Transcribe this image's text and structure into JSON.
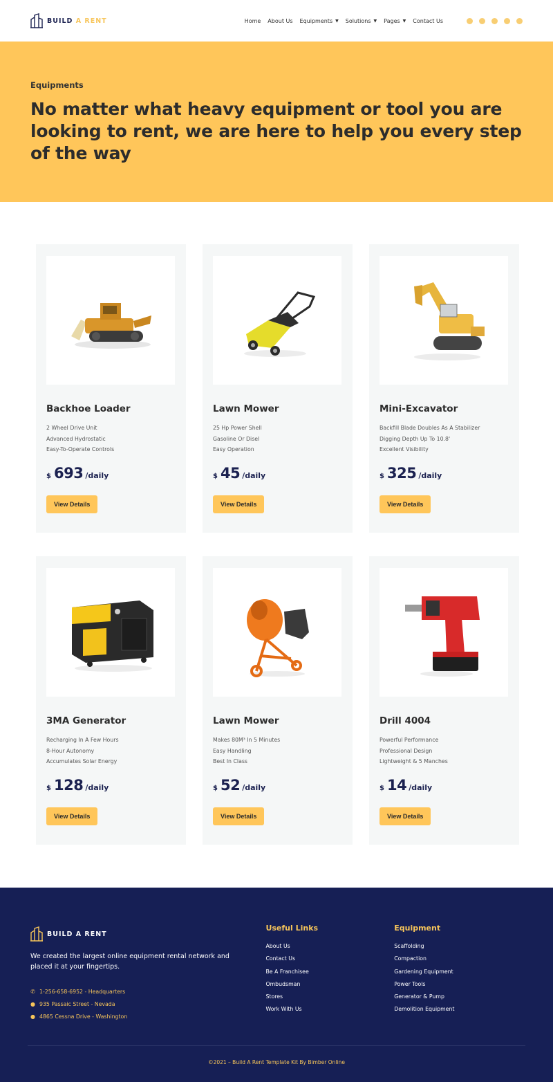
{
  "header": {
    "logo_primary": "BUILD",
    "logo_accent": "A RENT",
    "nav": [
      {
        "label": "Home",
        "dropdown": false
      },
      {
        "label": "About Us",
        "dropdown": false
      },
      {
        "label": "Equipments",
        "dropdown": true
      },
      {
        "label": "Solutions",
        "dropdown": true
      },
      {
        "label": "Pages",
        "dropdown": true
      },
      {
        "label": "Contact Us",
        "dropdown": false
      }
    ],
    "socials": [
      "instagram-icon",
      "facebook-icon",
      "twitter-icon",
      "youtube-icon",
      "dribbble-icon"
    ]
  },
  "hero": {
    "eyebrow": "Equipments",
    "title": "No matter what heavy equipment or tool you are looking to rent, we are here to help you every step of the way"
  },
  "products": [
    {
      "title": "Backhoe Loader",
      "features": [
        "2 Wheel Drive Unit",
        "Advanced Hydrostatic",
        "Easy-To-Operate Controls"
      ],
      "currency": "$",
      "price": "693",
      "per": "/daily",
      "button": "View Details",
      "image": "bulldozer"
    },
    {
      "title": "Lawn Mower",
      "features": [
        "25 Hp Power Shell",
        "Gasoline Or Disel",
        "Easy Operation"
      ],
      "currency": "$",
      "price": "45",
      "per": "/daily",
      "button": "View Details",
      "image": "lawn-mower"
    },
    {
      "title": "Mini-Excavator",
      "features": [
        "Backfill Blade Doubles As A Stabilizer",
        "Digging Depth Up To 10.8'",
        "Excellent Visibility"
      ],
      "currency": "$",
      "price": "325",
      "per": "/daily",
      "button": "View Details",
      "image": "excavator"
    },
    {
      "title": "3MA Generator",
      "features": [
        "Recharging In A Few Hours",
        "8-Hour Autonomy",
        "Accumulates Solar Energy"
      ],
      "currency": "$",
      "price": "128",
      "per": "/daily",
      "button": "View Details",
      "image": "generator"
    },
    {
      "title": "Lawn Mower",
      "features": [
        "Makes 80M³ In 5 Minutes",
        "Easy Handling",
        "Best In Class"
      ],
      "currency": "$",
      "price": "52",
      "per": "/daily",
      "button": "View Details",
      "image": "cement-mixer"
    },
    {
      "title": "Drill 4004",
      "features": [
        "Powerful Performance",
        "Professional Design",
        "Lightweight & 5 Manches"
      ],
      "currency": "$",
      "price": "14",
      "per": "/daily",
      "button": "View Details",
      "image": "drill"
    }
  ],
  "footer": {
    "logo": "BUILD A RENT",
    "description": "We created the largest online equipment rental network and placed it at your fingertips.",
    "contacts": [
      {
        "icon": "phone-icon",
        "text": "1-256-658-6952 - Headquarters"
      },
      {
        "icon": "map-pin-icon",
        "text": "935 Passaic Street - Nevada"
      },
      {
        "icon": "map-pin-icon",
        "text": "4865 Cessna Drive - Washington"
      }
    ],
    "useful_links": {
      "heading": "Useful Links",
      "items": [
        "About Us",
        "Contact Us",
        "Be A Franchisee",
        "Ombudsman",
        "Stores",
        "Work With Us"
      ]
    },
    "equipment": {
      "heading": "Equipment",
      "items": [
        "Scaffolding",
        "Compaction",
        "Gardening Equipment",
        "Power Tools",
        "Generator & Pump",
        "Demolition Equipment"
      ]
    },
    "copyright": "©2021 – Build A Rent Template Kit By Bimber Online"
  },
  "colors": {
    "accent": "#ffc65a",
    "navy": "#161f55",
    "card_bg": "#f5f7f7"
  }
}
